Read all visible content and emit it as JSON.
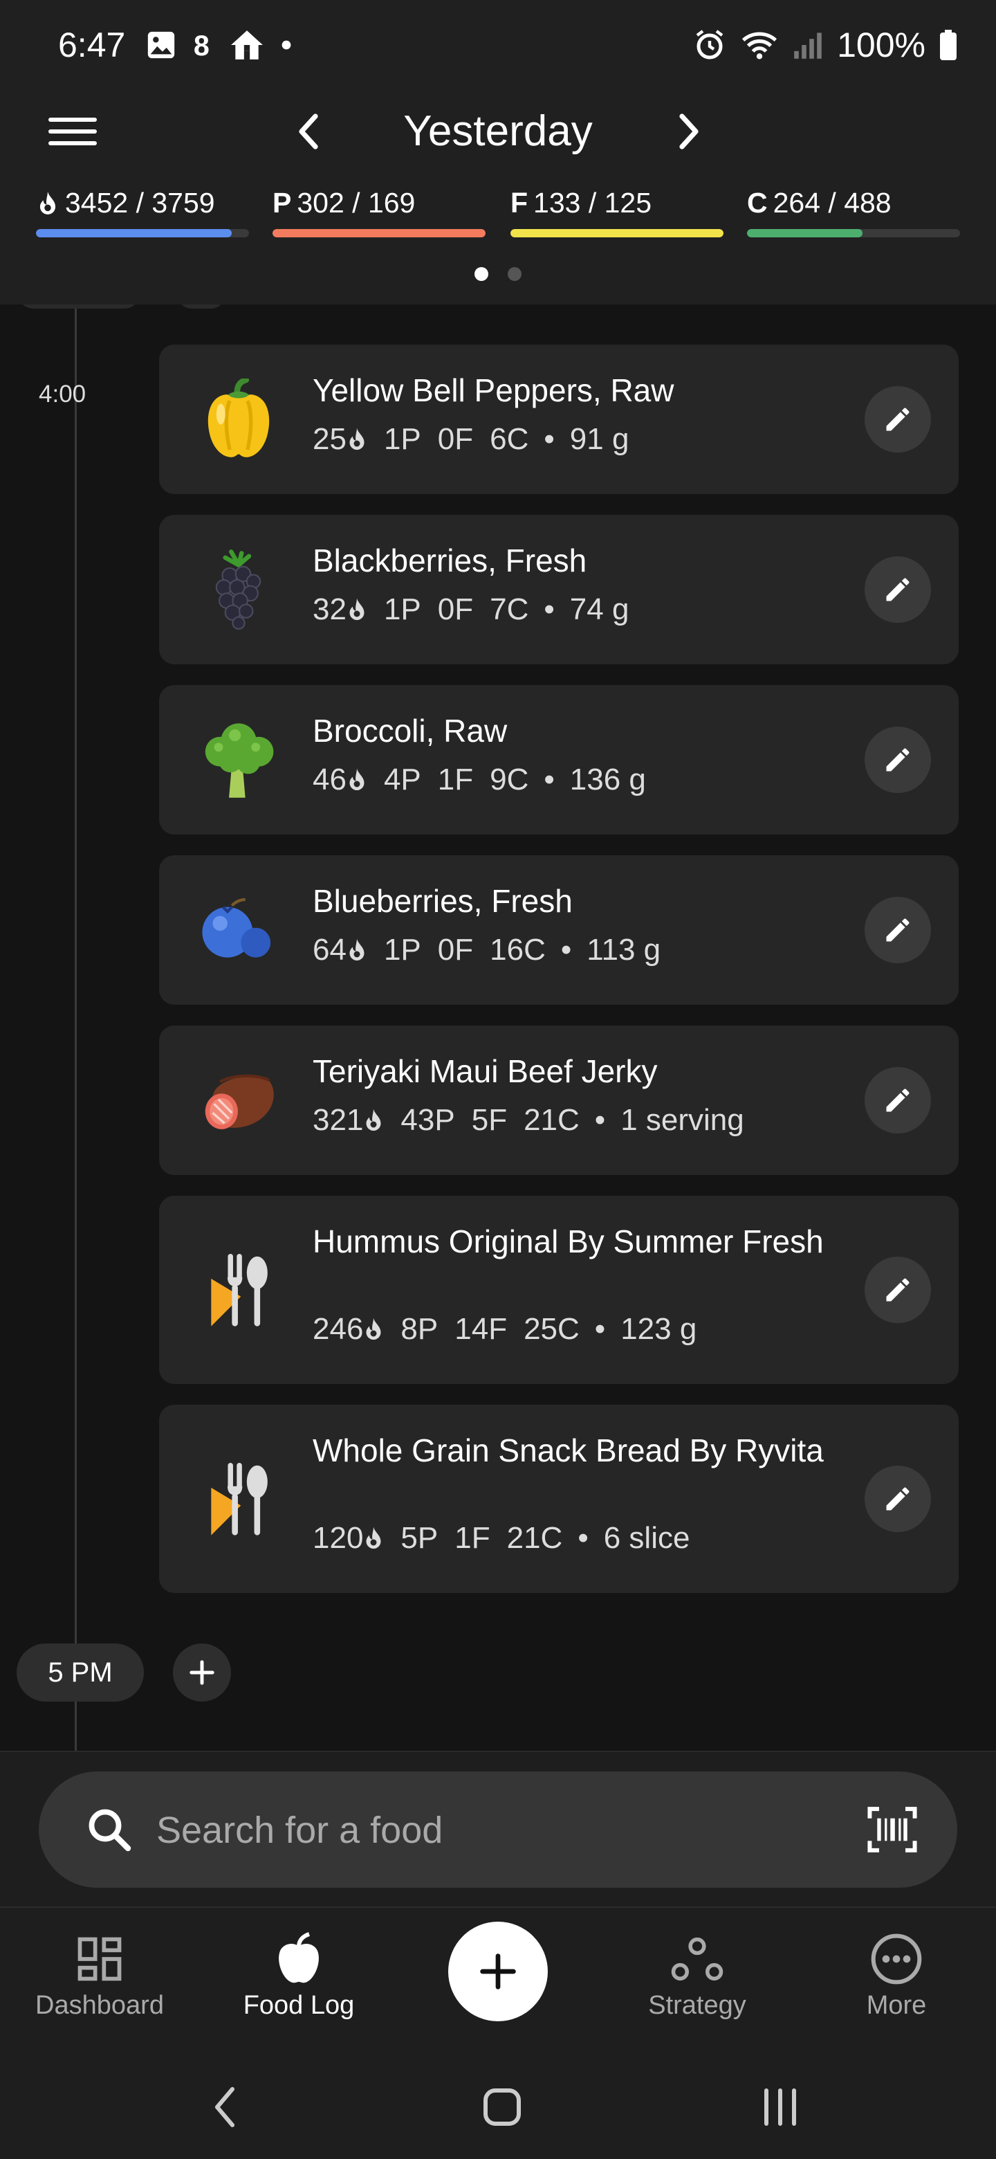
{
  "status_bar": {
    "time": "6:47",
    "battery": "100%"
  },
  "header": {
    "title": "Yesterday",
    "macros": [
      {
        "prefix": "",
        "value": "3452 / 3759",
        "color": "#5b8def",
        "fraction": 0.918
      },
      {
        "prefix": "P",
        "value": "302 / 169",
        "color": "#f47c5e",
        "fraction": 1.0
      },
      {
        "prefix": "F",
        "value": "133 / 125",
        "color": "#f2e34a",
        "fraction": 1.0
      },
      {
        "prefix": "C",
        "value": "264 / 488",
        "color": "#4caf6e",
        "fraction": 0.541
      }
    ]
  },
  "timeline": {
    "time_label": "4:00",
    "hour_chip": "5 PM",
    "entries": [
      {
        "name": "Yellow Bell Peppers, Raw",
        "kcal": "25",
        "p": "1P",
        "f": "0F",
        "c": "6C",
        "amount": "91 g",
        "icon": "bell-pepper"
      },
      {
        "name": "Blackberries, Fresh",
        "kcal": "32",
        "p": "1P",
        "f": "0F",
        "c": "7C",
        "amount": "74 g",
        "icon": "blackberry"
      },
      {
        "name": "Broccoli, Raw",
        "kcal": "46",
        "p": "4P",
        "f": "1F",
        "c": "9C",
        "amount": "136 g",
        "icon": "broccoli"
      },
      {
        "name": "Blueberries, Fresh",
        "kcal": "64",
        "p": "1P",
        "f": "0F",
        "c": "16C",
        "amount": "113 g",
        "icon": "blueberry"
      },
      {
        "name": "Teriyaki Maui Beef Jerky",
        "kcal": "321",
        "p": "43P",
        "f": "5F",
        "c": "21C",
        "amount": "1 serving",
        "icon": "meat"
      },
      {
        "name": "Hummus Original By Summer Fresh",
        "kcal": "246",
        "p": "8P",
        "f": "14F",
        "c": "25C",
        "amount": "123 g",
        "icon": "fork-knife"
      },
      {
        "name": "Whole Grain Snack Bread By Ryvita",
        "kcal": "120",
        "p": "5P",
        "f": "1F",
        "c": "21C",
        "amount": "6 slice",
        "icon": "fork-knife"
      }
    ]
  },
  "search": {
    "placeholder": "Search for a food"
  },
  "bottom_nav": {
    "items": [
      {
        "label": "Dashboard"
      },
      {
        "label": "Food Log"
      },
      {
        "label": "Strategy"
      },
      {
        "label": "More"
      }
    ]
  }
}
